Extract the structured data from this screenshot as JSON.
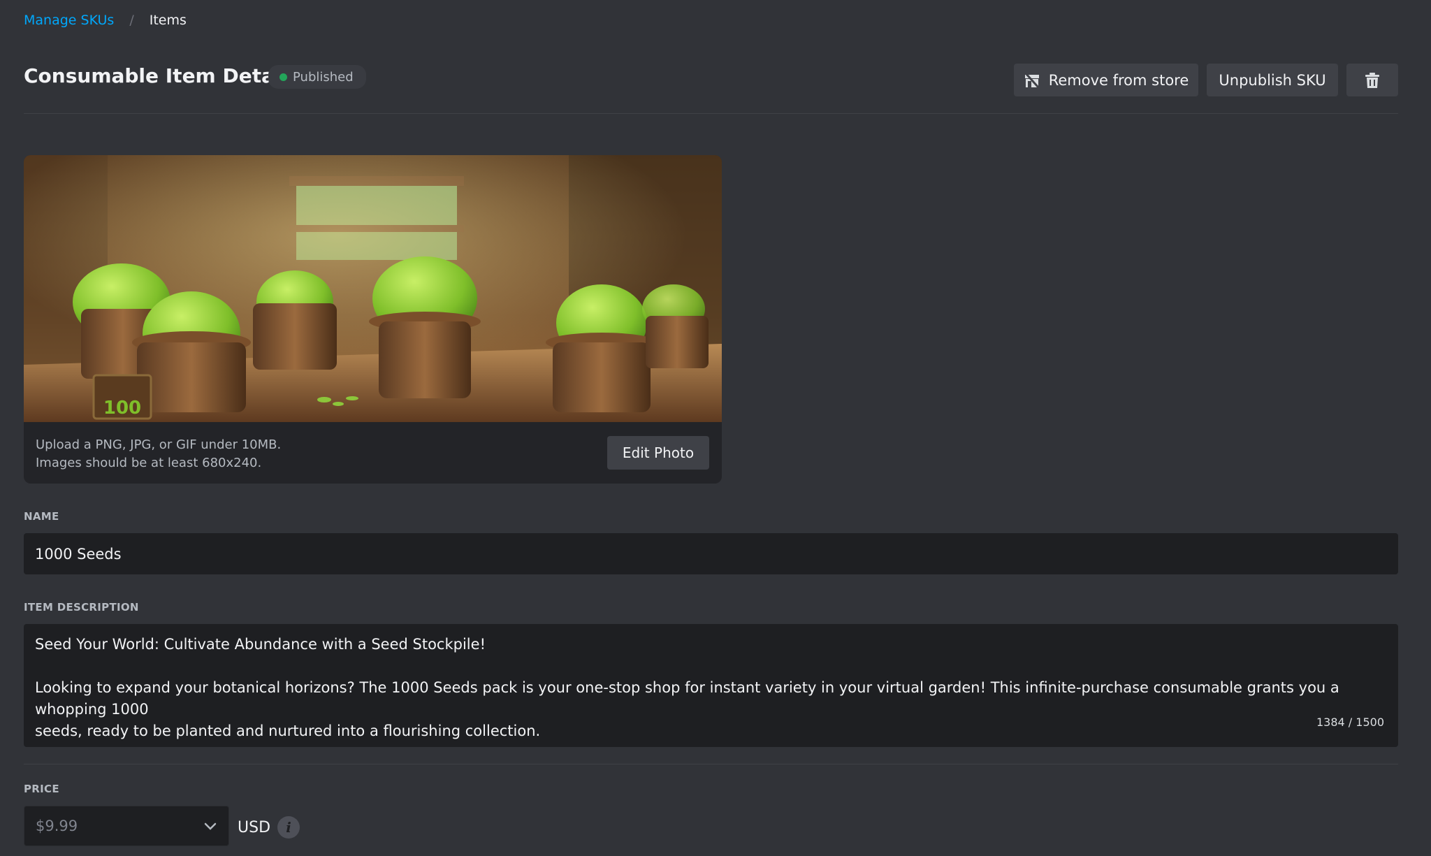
{
  "breadcrumb": {
    "parent": "Manage SKUs",
    "separator": "/",
    "current": "Items"
  },
  "header": {
    "title": "Consumable Item Details",
    "status": "Published",
    "actions": {
      "remove_label": "Remove from store",
      "unpublish_label": "Unpublish SKU",
      "remove_icon": "store-remove-icon",
      "delete_icon": "trash-icon"
    }
  },
  "image_card": {
    "hint_line1": "Upload a PNG, JPG, or GIF under 10MB.",
    "hint_line2": "Images should be at least 680x240.",
    "edit_label": "Edit Photo",
    "sign_label": "100"
  },
  "name": {
    "label": "NAME",
    "value": "1000 Seeds"
  },
  "description": {
    "label": "ITEM DESCRIPTION",
    "line1": "Seed Your World: Cultivate Abundance with a Seed Stockpile!",
    "line2": "Looking to expand your botanical horizons? The 1000 Seeds pack is your one-stop shop for instant variety in your virtual garden! This infinite-purchase consumable grants you a whopping 1000",
    "line3": "seeds, ready to be planted and nurtured into a flourishing collection.",
    "char_count": "1384 / 1500"
  },
  "price": {
    "label": "PRICE",
    "value": "$9.99",
    "currency": "USD",
    "info_icon": "i"
  },
  "colors": {
    "background": "#313338",
    "input_bg": "#1e1f22",
    "link": "#00a8fc",
    "published": "#23a55a"
  }
}
